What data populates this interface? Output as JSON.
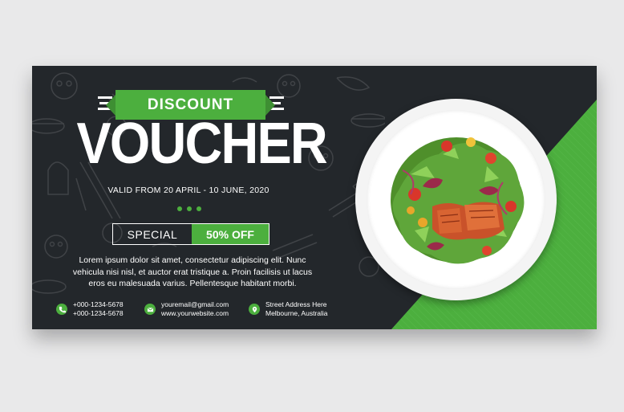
{
  "badge": "DISCOUNT",
  "title": "VOUCHER",
  "valid": "VALID FROM 20 APRIL - 10 JUNE, 2020",
  "special_label": "SPECIAL",
  "special_value": "50% OFF",
  "description": "Lorem ipsum dolor sit amet, consectetur adipiscing elit. Nunc vehicula nisi nisl, et auctor erat tristique a. Proin facilisis ut lacus eros eu malesuada varius. Pellentesque habitant morbi.",
  "contacts": [
    {
      "icon": "phone-icon",
      "line1": "+000-1234-5678",
      "line2": "+000-1234-5678"
    },
    {
      "icon": "email-icon",
      "line1": "youremail@gmail.com",
      "line2": "www.yourwebsite.com"
    },
    {
      "icon": "location-pin-icon",
      "line1": "Street Address Here",
      "line2": "Melbourne, Australia"
    }
  ],
  "colors": {
    "accent": "#4caf3e",
    "background": "#23272b"
  }
}
